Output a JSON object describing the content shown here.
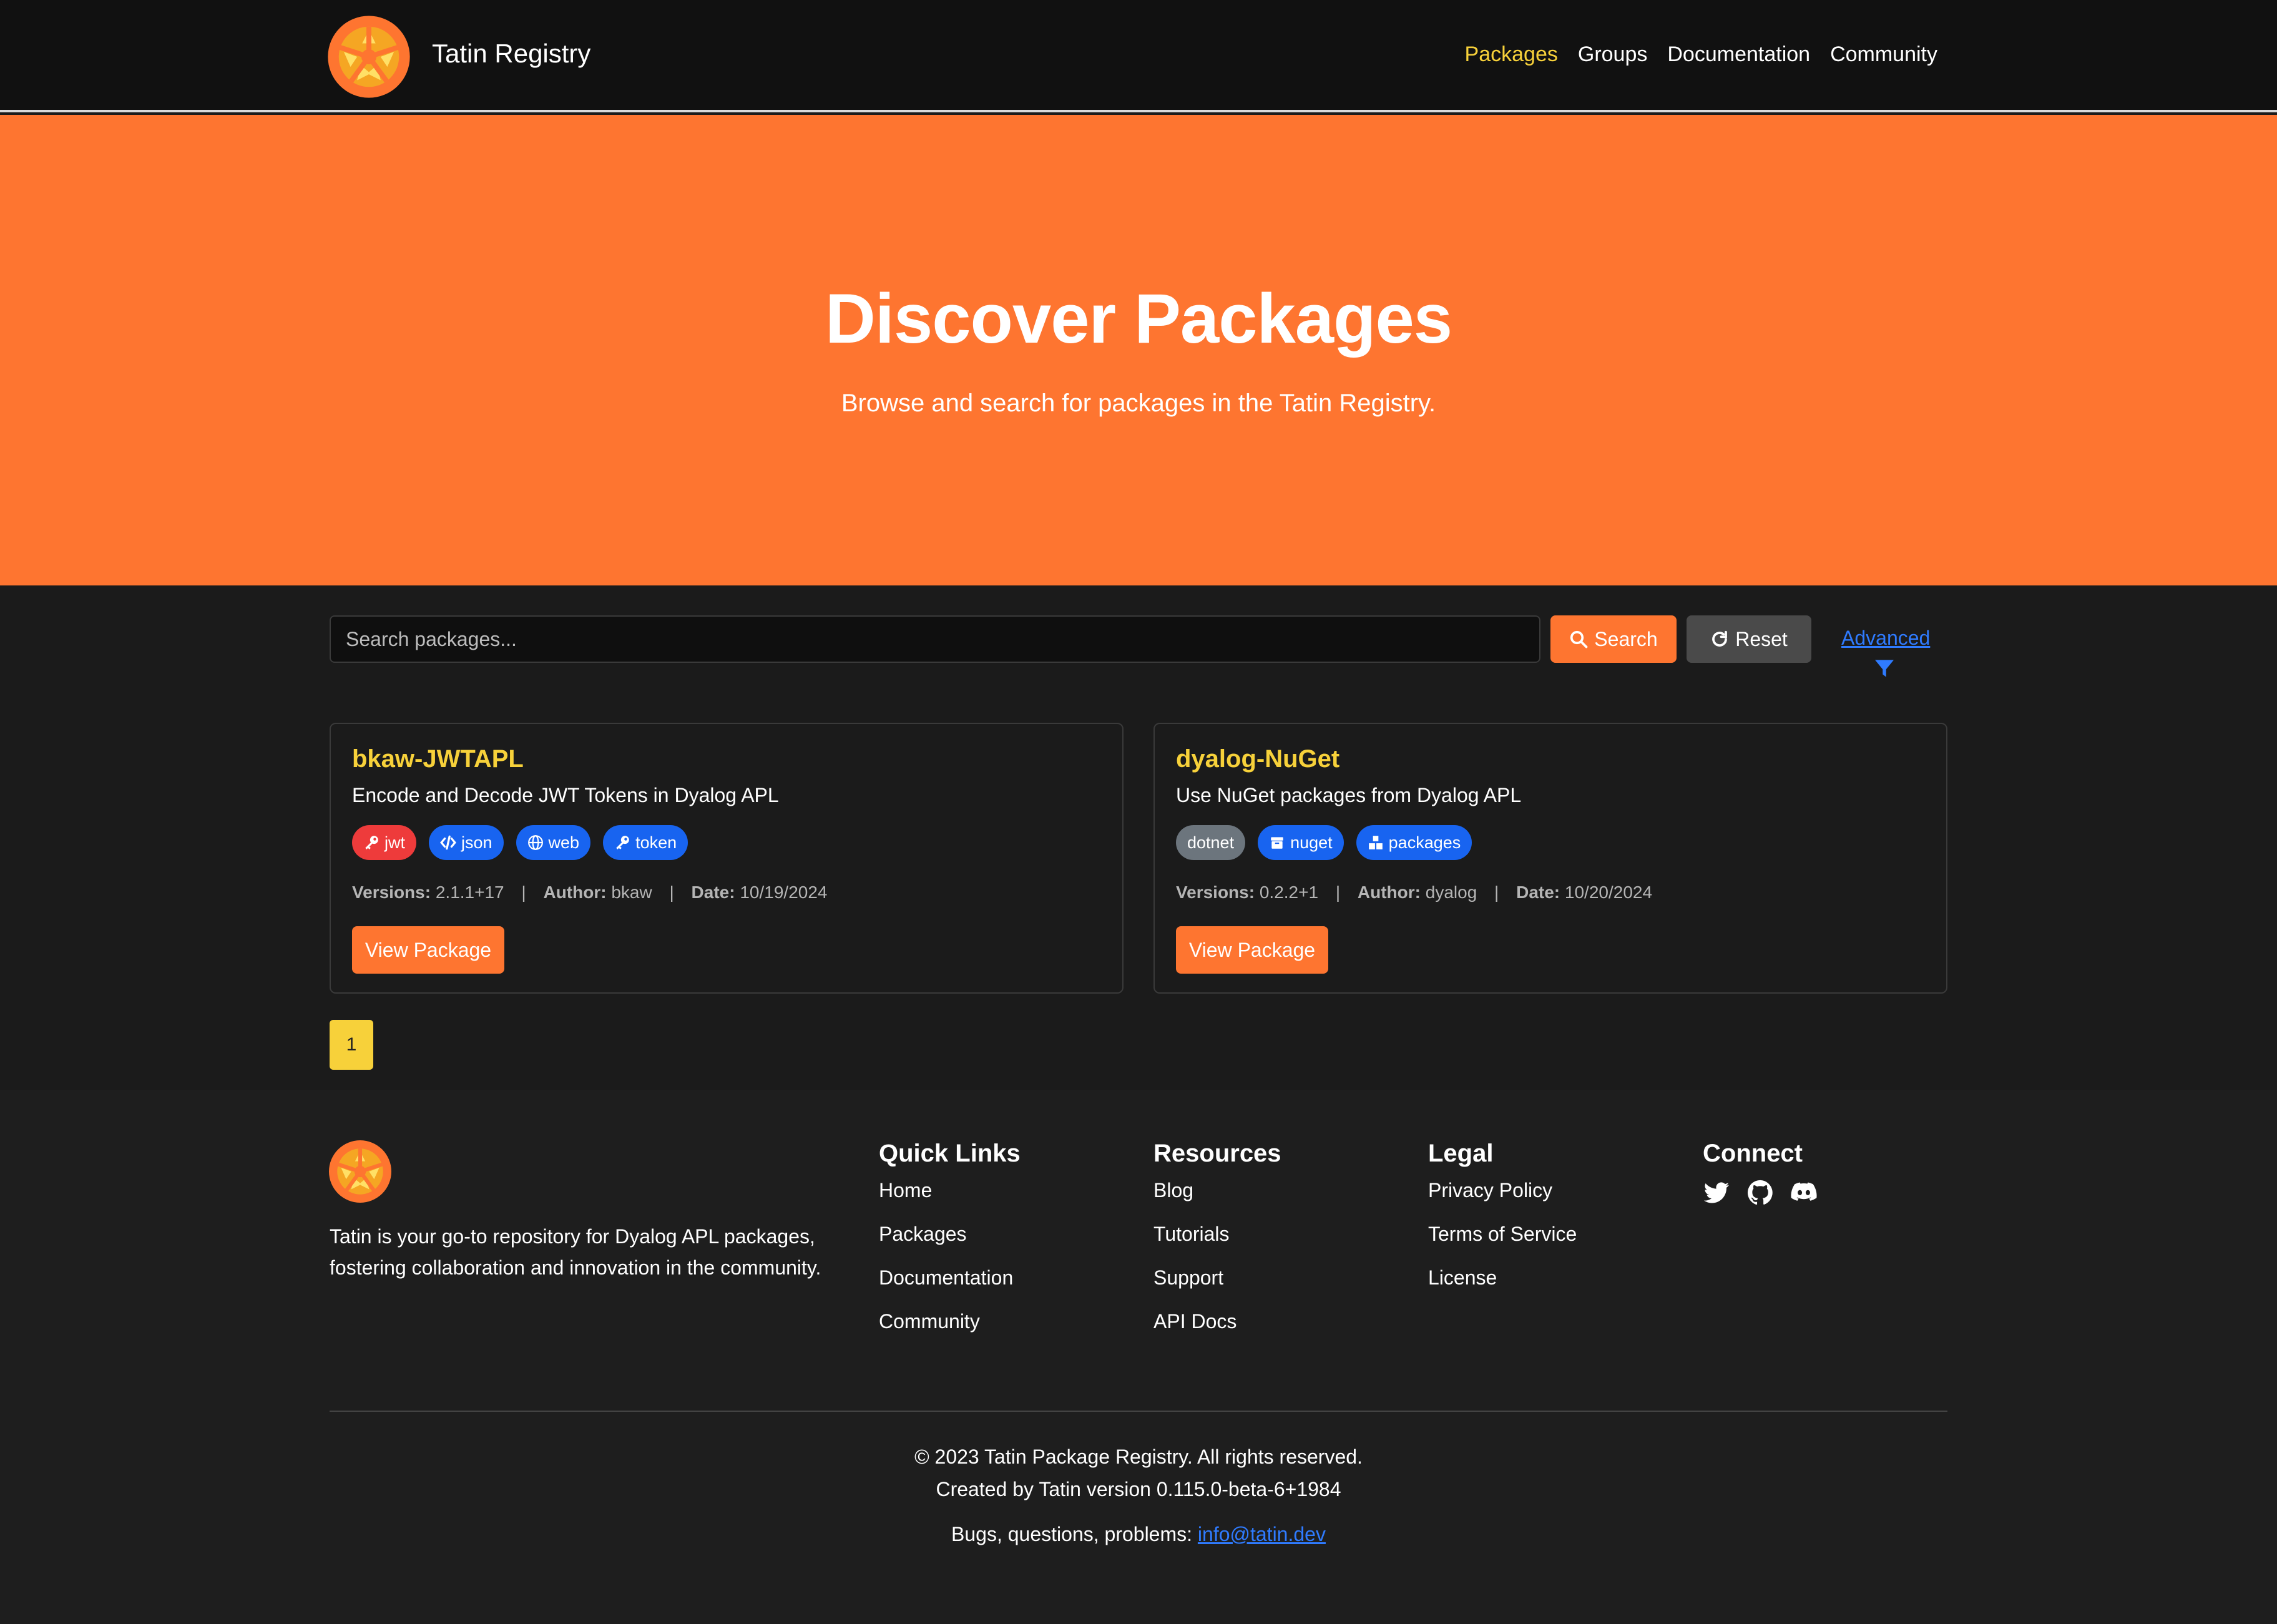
{
  "colors": {
    "accent": "#fe7530",
    "highlight": "#f7d13a",
    "link": "#2f7bff",
    "background": "#1b1b1b",
    "navbar": "#111111"
  },
  "navbar": {
    "brand": "Tatin Registry",
    "links": [
      {
        "label": "Packages",
        "active": true
      },
      {
        "label": "Groups",
        "active": false
      },
      {
        "label": "Documentation",
        "active": false
      },
      {
        "label": "Community",
        "active": false
      }
    ]
  },
  "hero": {
    "title": "Discover Packages",
    "subtitle": "Browse and search for packages in the Tatin Registry."
  },
  "search": {
    "placeholder": "Search packages...",
    "value": "",
    "search_label": "Search",
    "reset_label": "Reset",
    "advanced_label": "Advanced"
  },
  "packages": [
    {
      "name": "bkaw-JWTAPL",
      "description": "Encode and Decode JWT Tokens in Dyalog APL",
      "tags": [
        {
          "label": "jwt",
          "icon": "key-icon",
          "color": "#ee3b3b"
        },
        {
          "label": "json",
          "icon": "code-icon",
          "color": "#1864f0"
        },
        {
          "label": "web",
          "icon": "globe-icon",
          "color": "#1864f0"
        },
        {
          "label": "token",
          "icon": "key-icon",
          "color": "#1864f0"
        }
      ],
      "versions_label": "Versions:",
      "versions": "2.1.1+17",
      "author_label": "Author:",
      "author": "bkaw",
      "date_label": "Date:",
      "date": "10/19/2024",
      "button_label": "View Package"
    },
    {
      "name": "dyalog-NuGet",
      "description": "Use NuGet packages from Dyalog APL",
      "tags": [
        {
          "label": "dotnet",
          "icon": "",
          "color": "#6c757d"
        },
        {
          "label": "nuget",
          "icon": "box-icon",
          "color": "#1864f0"
        },
        {
          "label": "packages",
          "icon": "boxes-icon",
          "color": "#1864f0"
        }
      ],
      "versions_label": "Versions:",
      "versions": "0.2.2+1",
      "author_label": "Author:",
      "author": "dyalog",
      "date_label": "Date:",
      "date": "10/20/2024",
      "button_label": "View Package"
    }
  ],
  "pagination": {
    "current": "1"
  },
  "footer": {
    "about": "Tatin is your go-to repository for Dyalog APL packages, fostering collaboration and innovation in the community.",
    "quick_links": {
      "title": "Quick Links",
      "items": [
        "Home",
        "Packages",
        "Documentation",
        "Community"
      ]
    },
    "resources": {
      "title": "Resources",
      "items": [
        "Blog",
        "Tutorials",
        "Support",
        "API Docs"
      ]
    },
    "legal": {
      "title": "Legal",
      "items": [
        "Privacy Policy",
        "Terms of Service",
        "License"
      ]
    },
    "connect": {
      "title": "Connect",
      "icons": [
        "twitter-icon",
        "github-icon",
        "discord-icon"
      ]
    },
    "copyright": "© 2023 Tatin Package Registry. All rights reserved.",
    "version": "Created by Tatin version 0.115.0-beta-6+1984",
    "contact_prefix": "Bugs, questions, problems: ",
    "contact_email": "info@tatin.dev"
  }
}
